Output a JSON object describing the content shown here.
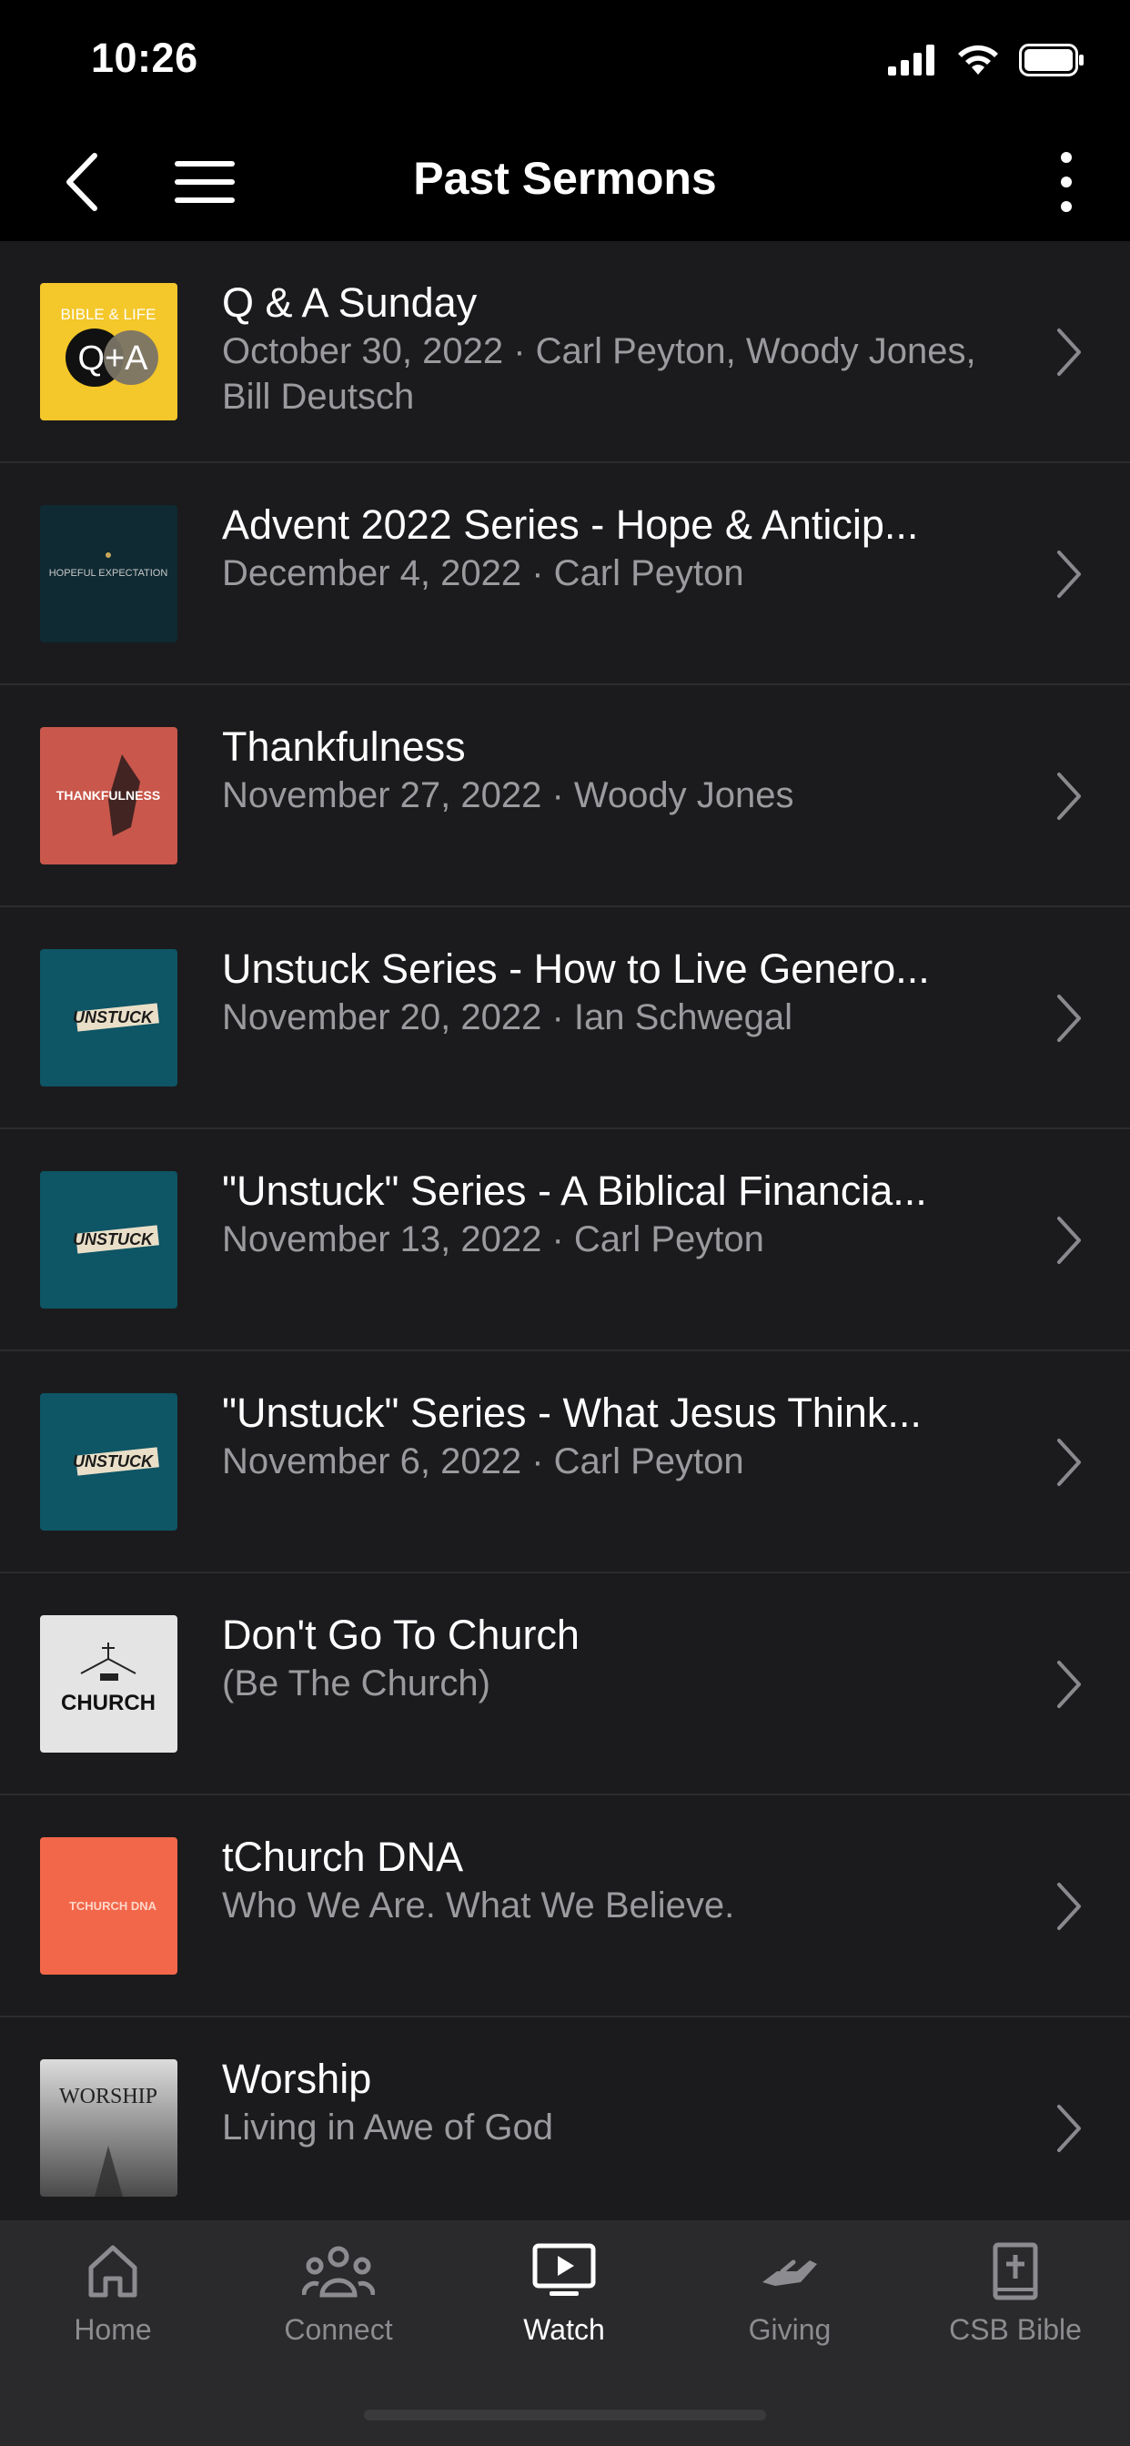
{
  "status": {
    "time": "10:26"
  },
  "nav": {
    "title": "Past Sermons"
  },
  "sermons": [
    {
      "title": "Q & A Sunday",
      "subtitle": "October 30, 2022 · Carl Peyton, Woody Jones, Bill Deutsch",
      "thumb_text": "BIBLE & LIFE",
      "thumb_text2": "Q+A"
    },
    {
      "title": "Advent 2022 Series - Hope & Anticip...",
      "subtitle": "December 4, 2022 · Carl Peyton",
      "thumb_text": "HOPEFUL EXPECTATION"
    },
    {
      "title": "Thankfulness",
      "subtitle": "November 27, 2022 · Woody Jones",
      "thumb_text": "THANKFULNESS"
    },
    {
      "title": "Unstuck Series - How to Live Genero...",
      "subtitle": "November 20, 2022 · Ian Schwegal",
      "thumb_text": "UNSTUCK"
    },
    {
      "title": "\"Unstuck\" Series - A Biblical Financia...",
      "subtitle": "November 13, 2022 · Carl Peyton",
      "thumb_text": "UNSTUCK"
    },
    {
      "title": "\"Unstuck\" Series - What Jesus Think...",
      "subtitle": "November 6, 2022 · Carl Peyton",
      "thumb_text": "UNSTUCK"
    },
    {
      "title": "Don't Go To Church",
      "subtitle": "(Be The Church)",
      "thumb_text": "CHURCH"
    },
    {
      "title": "tChurch DNA",
      "subtitle": "Who We Are. What We Believe.",
      "thumb_text": "TCHURCH DNA"
    },
    {
      "title": "Worship",
      "subtitle": "Living in Awe of God",
      "thumb_text": "WORSHIP"
    }
  ],
  "tabs": [
    {
      "label": "Home",
      "icon": "home-icon"
    },
    {
      "label": "Connect",
      "icon": "group-icon"
    },
    {
      "label": "Watch",
      "icon": "play-screen-icon",
      "active": true
    },
    {
      "label": "Giving",
      "icon": "giving-hand-icon"
    },
    {
      "label": "CSB Bible",
      "icon": "bible-icon"
    }
  ],
  "colors": {
    "background": "#1b1b1d",
    "bar": "#000000",
    "tab_bar": "#2a2a2c",
    "subtitle": "#9b9b9f",
    "divider": "#2c2c2f"
  }
}
